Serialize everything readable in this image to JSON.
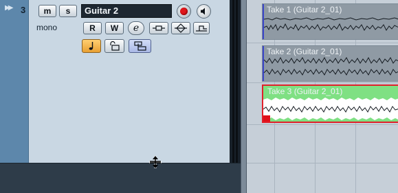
{
  "track": {
    "number": "3",
    "name": "Guitar 2",
    "channel_mode": "mono",
    "expand_icon": "double-chevron-right-icon",
    "buttons": {
      "mute": "m",
      "solo": "s",
      "read": "R",
      "write": "W",
      "edit": "e"
    },
    "colors": {
      "strip": "#5d87ab",
      "panel": "#c9d7e3",
      "record": "#e0161b",
      "timebase_active": "#f0b448",
      "lanes_active": "#b9c6ee"
    }
  },
  "takes": [
    {
      "label": "Take 1 (Guitar 2_01)",
      "selected": false
    },
    {
      "label": "Take 2 (Guitar 2_01)",
      "selected": false
    },
    {
      "label": "Take 3 (Guitar 2_01)",
      "selected": true
    }
  ],
  "cursor": "resize-vertical-cursor"
}
